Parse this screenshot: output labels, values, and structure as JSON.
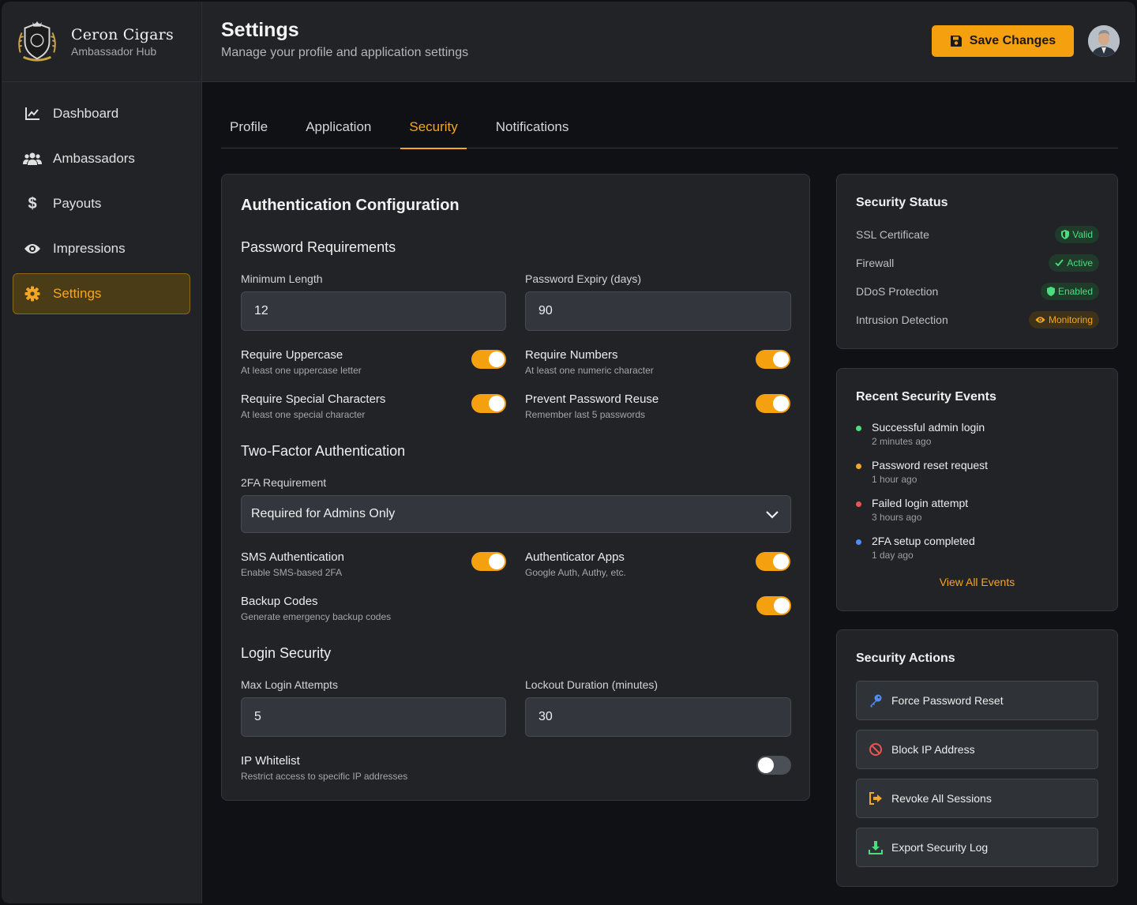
{
  "brand": {
    "name": "Ceron Cigars",
    "subtitle": "Ambassador Hub"
  },
  "sidebar": {
    "items": [
      {
        "label": "Dashboard",
        "icon": "chart-line-icon"
      },
      {
        "label": "Ambassadors",
        "icon": "users-icon"
      },
      {
        "label": "Payouts",
        "icon": "dollar-icon"
      },
      {
        "label": "Impressions",
        "icon": "eye-icon"
      },
      {
        "label": "Settings",
        "icon": "gear-icon",
        "active": true
      }
    ]
  },
  "header": {
    "title": "Settings",
    "subtitle": "Manage your profile and application settings",
    "save_label": "Save Changes"
  },
  "tabs": [
    {
      "label": "Profile"
    },
    {
      "label": "Application"
    },
    {
      "label": "Security",
      "active": true
    },
    {
      "label": "Notifications"
    }
  ],
  "auth": {
    "title": "Authentication Configuration",
    "password": {
      "title": "Password Requirements",
      "min_length_label": "Minimum Length",
      "min_length_value": "12",
      "expiry_label": "Password Expiry (days)",
      "expiry_value": "90",
      "toggles": [
        {
          "title": "Require Uppercase",
          "desc": "At least one uppercase letter",
          "on": true
        },
        {
          "title": "Require Numbers",
          "desc": "At least one numeric character",
          "on": true
        },
        {
          "title": "Require Special Characters",
          "desc": "At least one special character",
          "on": true
        },
        {
          "title": "Prevent Password Reuse",
          "desc": "Remember last 5 passwords",
          "on": true
        }
      ]
    },
    "twofa": {
      "title": "Two-Factor Authentication",
      "requirement_label": "2FA Requirement",
      "requirement_value": "Required for Admins Only",
      "toggles": [
        {
          "title": "SMS Authentication",
          "desc": "Enable SMS-based 2FA",
          "on": true
        },
        {
          "title": "Authenticator Apps",
          "desc": "Google Auth, Authy, etc.",
          "on": true
        },
        {
          "title": "Backup Codes",
          "desc": "Generate emergency backup codes",
          "on": true
        }
      ]
    },
    "login": {
      "title": "Login Security",
      "max_attempts_label": "Max Login Attempts",
      "max_attempts_value": "5",
      "lockout_label": "Lockout Duration (minutes)",
      "lockout_value": "30",
      "ip_whitelist": {
        "title": "IP Whitelist",
        "desc": "Restrict access to specific IP addresses",
        "on": false
      }
    }
  },
  "status": {
    "title": "Security Status",
    "rows": [
      {
        "label": "SSL Certificate",
        "badge": "Valid",
        "icon": "shield-icon"
      },
      {
        "label": "Firewall",
        "badge": "Active",
        "icon": "check-icon"
      },
      {
        "label": "DDoS Protection",
        "badge": "Enabled",
        "icon": "shield-icon"
      },
      {
        "label": "Intrusion Detection",
        "badge": "Monitoring",
        "icon": "eye-icon"
      }
    ]
  },
  "events": {
    "title": "Recent Security Events",
    "items": [
      {
        "title": "Successful admin login",
        "time": "2 minutes ago",
        "color": "#4ade80"
      },
      {
        "title": "Password reset request",
        "time": "1 hour ago",
        "color": "#f5a623"
      },
      {
        "title": "Failed login attempt",
        "time": "3 hours ago",
        "color": "#f05252"
      },
      {
        "title": "2FA setup completed",
        "time": "1 day ago",
        "color": "#4f8ef7"
      }
    ],
    "view_all": "View All Events"
  },
  "actions": {
    "title": "Security Actions",
    "items": [
      {
        "label": "Force Password Reset",
        "icon": "key-icon"
      },
      {
        "label": "Block IP Address",
        "icon": "ban-icon"
      },
      {
        "label": "Revoke All Sessions",
        "icon": "sign-out-icon"
      },
      {
        "label": "Export Security Log",
        "icon": "download-icon"
      }
    ]
  },
  "colors": {
    "accent": "#f5a00f",
    "success": "#4ade80",
    "danger": "#f05252",
    "info": "#4f8ef7"
  }
}
